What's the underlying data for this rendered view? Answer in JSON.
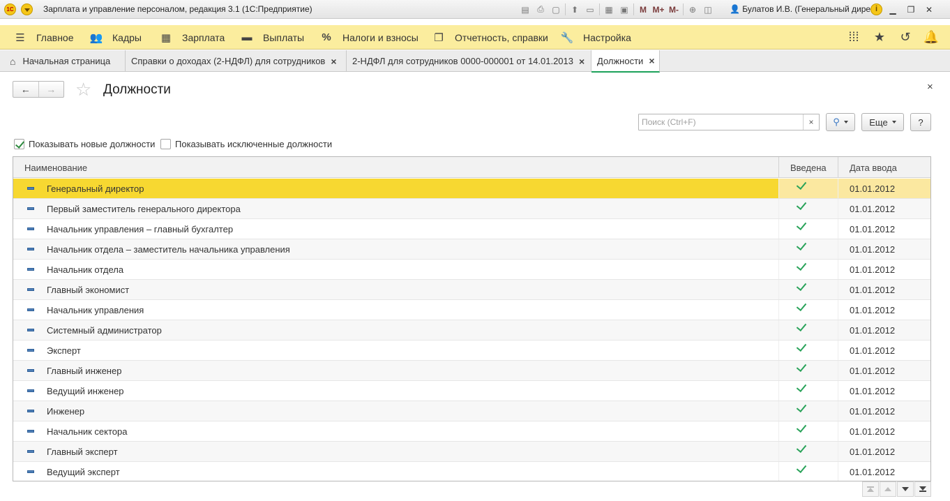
{
  "window": {
    "logo": "1С",
    "title": "Зарплата и управление персоналом, редакция 3.1  (1С:Предприятие)",
    "memory_buttons": [
      "M",
      "M+",
      "M-"
    ],
    "user": "Булатов И.В. (Генеральный дирек..."
  },
  "sections": [
    {
      "label": "Главное",
      "icon": "hamburger-icon"
    },
    {
      "label": "Кадры",
      "icon": "people-icon"
    },
    {
      "label": "Зарплата",
      "icon": "calculator-icon"
    },
    {
      "label": "Выплаты",
      "icon": "wallet-icon"
    },
    {
      "label": "Налоги и взносы",
      "icon": "percent-icon"
    },
    {
      "label": "Отчетность, справки",
      "icon": "documents-icon"
    },
    {
      "label": "Настройка",
      "icon": "wrench-icon"
    }
  ],
  "tabs": [
    {
      "label": "Начальная страница",
      "active": false
    },
    {
      "label": "Справки о доходах (2-НДФЛ) для сотрудников",
      "active": false
    },
    {
      "label": "2-НДФЛ для сотрудников 0000-000001 от 14.01.2013",
      "active": false
    },
    {
      "label": "Должности",
      "active": true
    }
  ],
  "form": {
    "title": "Должности",
    "search_placeholder": "Поиск (Ctrl+F)",
    "more_button": "Еще",
    "help_button": "?",
    "show_new": {
      "label": "Показывать новые должности",
      "checked": true
    },
    "show_excluded": {
      "label": "Показывать исключенные должности",
      "checked": false
    }
  },
  "table": {
    "columns": [
      "Наименование",
      "Введена",
      "Дата ввода"
    ],
    "rows": [
      {
        "name": "Генеральный директор",
        "introduced": true,
        "date": "01.01.2012",
        "selected": true
      },
      {
        "name": "Первый заместитель генерального директора",
        "introduced": true,
        "date": "01.01.2012"
      },
      {
        "name": "Начальник управления – главный бухгалтер",
        "introduced": true,
        "date": "01.01.2012"
      },
      {
        "name": "Начальник отдела – заместитель начальника управления",
        "introduced": true,
        "date": "01.01.2012"
      },
      {
        "name": "Начальник отдела",
        "introduced": true,
        "date": "01.01.2012"
      },
      {
        "name": "Главный экономист",
        "introduced": true,
        "date": "01.01.2012"
      },
      {
        "name": "Начальник управления",
        "introduced": true,
        "date": "01.01.2012"
      },
      {
        "name": "Системный администратор",
        "introduced": true,
        "date": "01.01.2012"
      },
      {
        "name": "Эксперт",
        "introduced": true,
        "date": "01.01.2012"
      },
      {
        "name": "Главный инженер",
        "introduced": true,
        "date": "01.01.2012"
      },
      {
        "name": "Ведущий инженер",
        "introduced": true,
        "date": "01.01.2012"
      },
      {
        "name": "Инженер",
        "introduced": true,
        "date": "01.01.2012"
      },
      {
        "name": "Начальник сектора",
        "introduced": true,
        "date": "01.01.2012"
      },
      {
        "name": "Главный эксперт",
        "introduced": true,
        "date": "01.01.2012"
      },
      {
        "name": "Ведущий эксперт",
        "introduced": true,
        "date": "01.01.2012"
      }
    ]
  },
  "colors": {
    "section_panel": "#fbed9e",
    "selected_row": "#f7d831",
    "active_tab_underline": "#1ca15a",
    "check_mark": "#2aa35a"
  }
}
